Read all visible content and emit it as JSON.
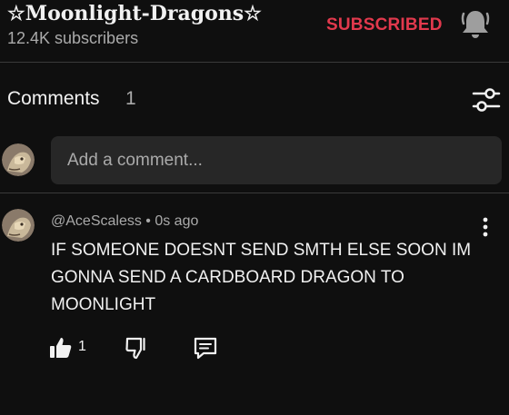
{
  "channel": {
    "name": "☆Moonlight-Dragons☆",
    "subscribers": "12.4K subscribers",
    "subscribe_label": "SUBSCRIBED",
    "bell_icon": "bell-icon"
  },
  "comments_header": {
    "title": "Comments",
    "count": "1",
    "filter_icon": "filter-sliders-icon"
  },
  "comment_input": {
    "placeholder": "Add a comment..."
  },
  "comments": [
    {
      "author": "@AceScaless",
      "time": "0s ago",
      "byline": "@AceScaless • 0s ago",
      "body": "IF SOMEONE DOESNT SEND SMTH ELSE SOON IM GONNA SEND A CARDBOARD DRAGON TO MOONLIGHT",
      "likes": "1",
      "actions": [
        "like-icon",
        "dislike-icon",
        "reply-icon",
        "more-vert-icon"
      ]
    }
  ],
  "colors": {
    "background": "#0f0f0f",
    "subscribed": "#e2394d",
    "input_bg": "#272727",
    "secondary_text": "#aaaaaa"
  }
}
